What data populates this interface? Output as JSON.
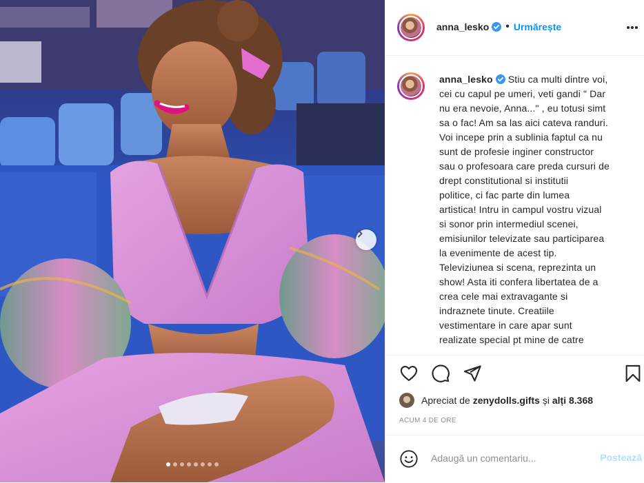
{
  "post": {
    "username": "anna_lesko",
    "follow_label": "Urmărește",
    "caption_lines": [
      "Stiu ca multi dintre voi,",
      "cei cu capul pe umeri, veti gandi \" Dar",
      "nu era nevoie, Anna...\" , eu totusi simt",
      "sa o fac! Am sa las aici cateva randuri.",
      "Voi incepe prin a sublinia faptul ca nu",
      "sunt de profesie inginer constructor",
      "sau o profesoara care preda cursuri de",
      "drept constitutional si institutii",
      "politice, ci fac parte din lumea",
      "artistica! Intru in campul vostru vizual",
      "si sonor prin intermediul scenei,",
      "emisiunilor televizate sau participarea",
      "la evenimente de acest tip.",
      "Televiziunea si scena, reprezinta un",
      "show! Asta iti confera libertatea de a",
      "crea cele mai extravagante si",
      "indraznete tinute. Creatiile",
      "vestimentare in care apar sunt",
      "realizate special pt mine de catre"
    ],
    "likes": {
      "prefix": "Apreciat de",
      "liker": "zenydolls.gifts",
      "conjunction": "și",
      "others": "alți 8.368"
    },
    "timestamp": "ACUM 4 DE ORE",
    "comment_placeholder": "Adaugă un comentariu...",
    "post_button": "Postează",
    "carousel": {
      "total": 8,
      "active": 1
    }
  },
  "colors": {
    "accent": "#0095f6",
    "post_disabled": "#b2dffc",
    "muted": "#8e8e8e",
    "text": "#262626",
    "verified": "#3897f0",
    "dress": "#d98fd6"
  }
}
